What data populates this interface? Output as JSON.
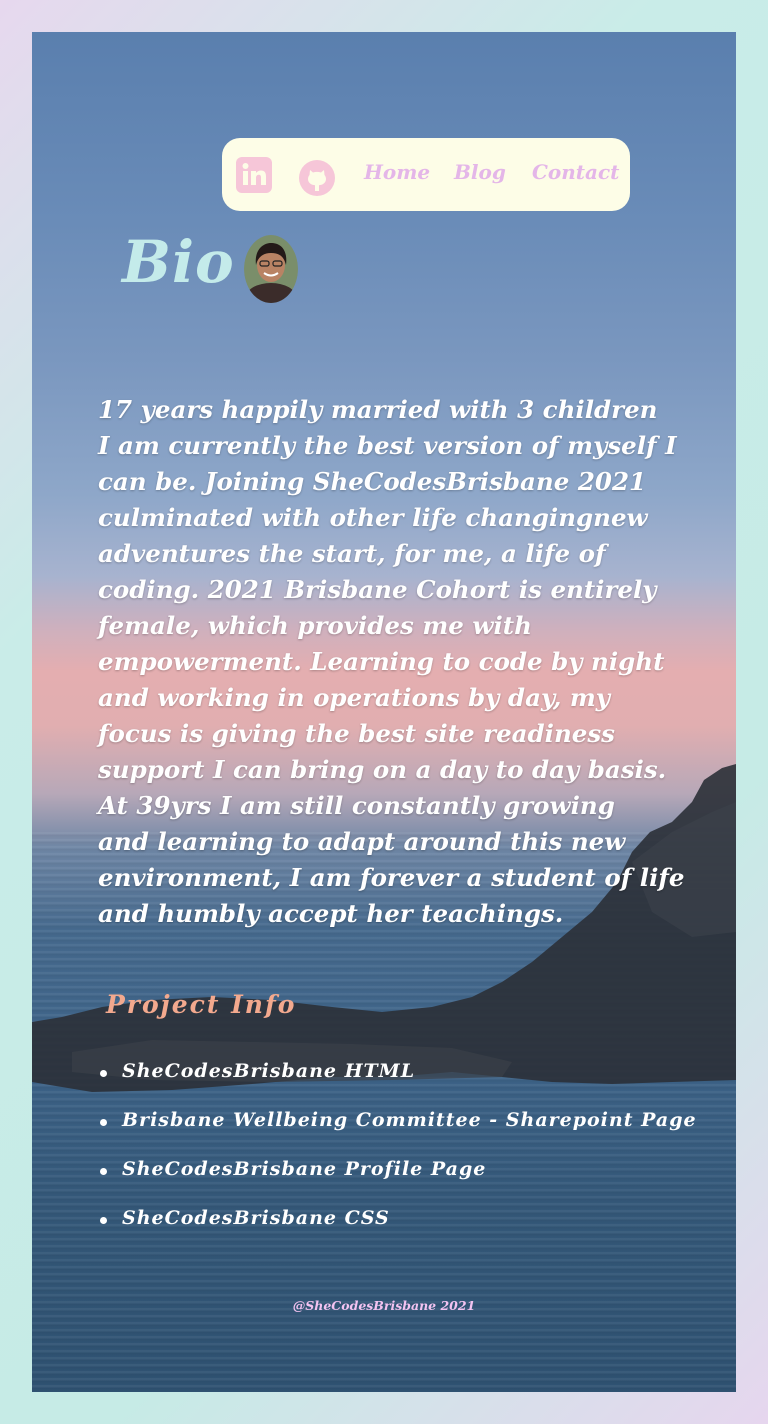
{
  "nav": {
    "icons": [
      "linkedin-icon",
      "github-icon"
    ],
    "links": [
      "Home",
      "Blog",
      "Contact"
    ]
  },
  "bio": {
    "title": "Bio",
    "lines": [
      "17 years happily married with 3 children",
      "I am currently the best version of myself I",
      "can be. Joining SheCodesBrisbane 2021",
      "culminated with other life changingnew",
      "adventures the start, for me, a life of",
      "coding. 2021 Brisbane Cohort is entirely",
      "female, which provides me with",
      "empowerment. Learning to code by night",
      "and working in operations by day, my",
      "focus is giving the best site readiness",
      "support I can bring on a day to day basis.",
      "At 39yrs I am still constantly growing",
      "and learning to adapt around this new",
      "environment, I am forever a student of life",
      "and humbly accept her teachings."
    ]
  },
  "projects": {
    "title": "Project Info",
    "items": [
      "SheCodesBrisbane HTML",
      "Brisbane Wellbeing Committee - Sharepoint Page",
      "SheCodesBrisbane Profile Page",
      "SheCodesBrisbane CSS"
    ]
  },
  "footer": {
    "text": "@SheCodesBrisbane 2021"
  },
  "colors": {
    "nav_bg": "#fdfde7",
    "link": "#e4b6e8",
    "icon": "#f6c6d8",
    "bio_title": "#c4ebea",
    "project_title": "#f3a98e",
    "footer": "#f3c3f1"
  }
}
